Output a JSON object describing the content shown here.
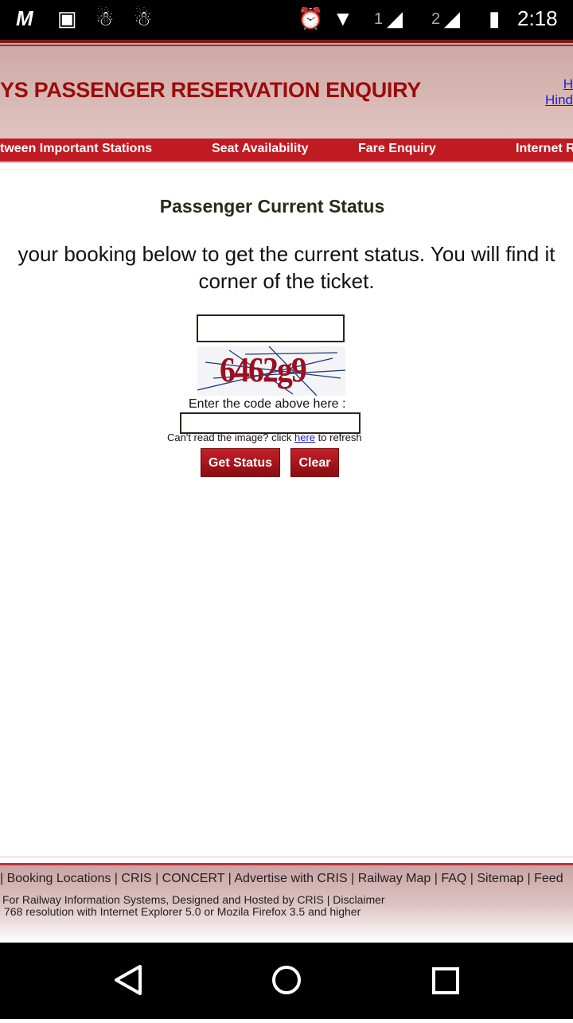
{
  "status_bar": {
    "time": "2:18",
    "sim1": "1",
    "sim2": "2",
    "icons": [
      "gmail-icon",
      "gallery-icon",
      "android-icon",
      "android-icon",
      "alarm-icon",
      "wifi-icon",
      "signal-icon",
      "signal-icon",
      "battery-charging-icon"
    ]
  },
  "header": {
    "title": "YS PASSENGER RESERVATION ENQUIRY",
    "lang_top": "H",
    "lang_bottom": "Hind"
  },
  "nav": [
    "tween Important Stations",
    "Seat Availability",
    "Fare Enquiry",
    "Internet R"
  ],
  "main": {
    "heading": "Passenger Current Status",
    "desc_line1": "your booking below to get the current status. You will find it",
    "desc_line2": "corner of the ticket.",
    "pnr_value": "",
    "captcha_text": "6462g9",
    "captcha_label": "Enter the code above here :",
    "captcha_value": "",
    "refresh_pre": "Can't read the image? click ",
    "refresh_link": "here",
    "refresh_post": " to refresh",
    "get_status": "Get Status",
    "clear": "Clear"
  },
  "footer": {
    "links": "| Booking Locations | CRIS | CONCERT | Advertise with CRIS | Railway Map | FAQ | Sitemap | Feed",
    "line1": "For Railway Information Systems, Designed and Hosted by CRIS | Disclaimer",
    "line2": "768 resolution with Internet Explorer 5.0 or Mozila Firefox 3.5 and higher"
  },
  "colors": {
    "brand": "#9c0a0a",
    "nav": "#c01a22"
  }
}
